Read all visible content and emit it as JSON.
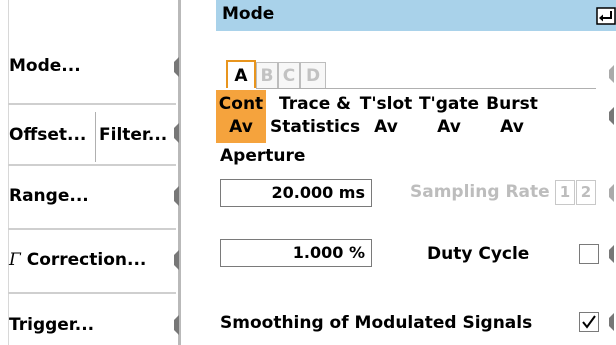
{
  "softkeys": {
    "items": [
      {
        "label": "Mode..."
      },
      {
        "label": "Offset...",
        "label2": "Filter..."
      },
      {
        "label": "Range..."
      },
      {
        "label": "Correction...",
        "prefix_symbol": "Γ"
      },
      {
        "label": "Trigger..."
      }
    ]
  },
  "mode_panel": {
    "title": "Mode",
    "enter_icon": "enter-icon",
    "tabs": [
      {
        "label": "A",
        "state": "active"
      },
      {
        "label": "B",
        "state": "inactive"
      },
      {
        "label": "C",
        "state": "inactive"
      },
      {
        "label": "D",
        "state": "inactive"
      }
    ],
    "modes": [
      {
        "line1": "Cont",
        "line2": "Av",
        "selected": true
      },
      {
        "line1": "Trace &",
        "line2": "Statistics",
        "selected": false
      },
      {
        "line1": "T'slot",
        "line2": "Av",
        "selected": false
      },
      {
        "line1": "T'gate",
        "line2": "Av",
        "selected": false
      },
      {
        "line1": "Burst",
        "line2": "Av",
        "selected": false
      }
    ],
    "aperture": {
      "label": "Aperture",
      "value": "20.000",
      "unit": "ms"
    },
    "sampling_rate": {
      "label": "Sampling Rate",
      "options": [
        "1",
        "2"
      ]
    },
    "duty_cycle": {
      "value": "1.000",
      "unit": "%",
      "label": "Duty Cycle",
      "checked": false
    },
    "smoothing": {
      "label": "Smoothing of Modulated Signals",
      "checked": true
    }
  },
  "colors": {
    "header_bg": "#a9d2ea",
    "accent_orange": "#f5a33d",
    "tab_border_active": "#e8951e",
    "disabled_text": "#bdbdbd"
  }
}
